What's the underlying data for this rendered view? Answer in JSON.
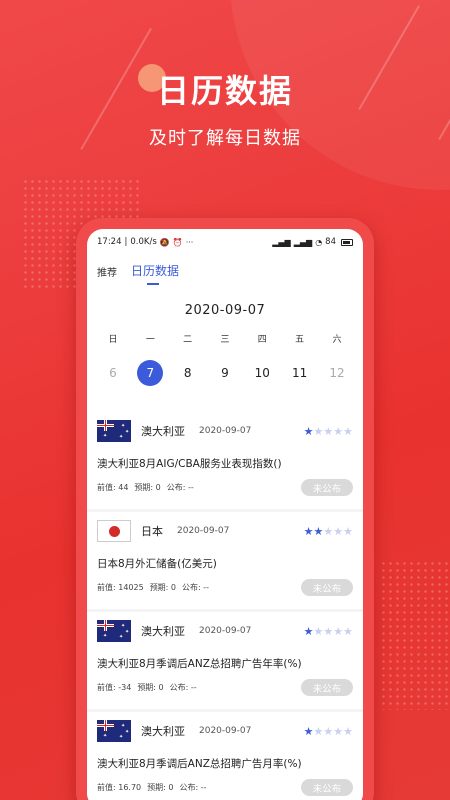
{
  "hero": {
    "title": "日历数据",
    "subtitle": "及时了解每日数据"
  },
  "statusbar": {
    "time": "17:24",
    "speed": "0.0K/s",
    "battery": "84"
  },
  "tabs": [
    {
      "label": "推荐",
      "active": false
    },
    {
      "label": "日历数据",
      "active": true
    }
  ],
  "calendar": {
    "date": "2020-09-07",
    "weekdays": [
      "日",
      "一",
      "二",
      "三",
      "四",
      "五",
      "六"
    ],
    "days": [
      {
        "d": "6",
        "state": "muted"
      },
      {
        "d": "7",
        "state": "selected"
      },
      {
        "d": "8",
        "state": "normal"
      },
      {
        "d": "9",
        "state": "normal"
      },
      {
        "d": "10",
        "state": "normal"
      },
      {
        "d": "11",
        "state": "normal"
      },
      {
        "d": "12",
        "state": "muted"
      }
    ]
  },
  "items": [
    {
      "country": "澳大利亚",
      "flag": "au",
      "date": "2020-09-07",
      "stars": 1,
      "title": "澳大利亚8月AIG/CBA服务业表现指数()",
      "prev": "前值: 44",
      "forecast": "预期: 0",
      "actual": "公布: --",
      "button": "未公布"
    },
    {
      "country": "日本",
      "flag": "jp",
      "date": "2020-09-07",
      "stars": 2,
      "title": "日本8月外汇储备(亿美元)",
      "prev": "前值: 14025",
      "forecast": "预期: 0",
      "actual": "公布: --",
      "button": "未公布"
    },
    {
      "country": "澳大利亚",
      "flag": "au",
      "date": "2020-09-07",
      "stars": 1,
      "title": "澳大利亚8月季调后ANZ总招聘广告年率(%)",
      "prev": "前值: -34",
      "forecast": "预期: 0",
      "actual": "公布: --",
      "button": "未公布"
    },
    {
      "country": "澳大利亚",
      "flag": "au",
      "date": "2020-09-07",
      "stars": 1,
      "title": "澳大利亚8月季调后ANZ总招聘广告月率(%)",
      "prev": "前值: 16.70",
      "forecast": "预期: 0",
      "actual": "公布: --",
      "button": "未公布"
    }
  ],
  "colors": {
    "background": "#ee3a3a",
    "accent": "#3b5bdb",
    "button_gray": "#d9d9d9"
  }
}
